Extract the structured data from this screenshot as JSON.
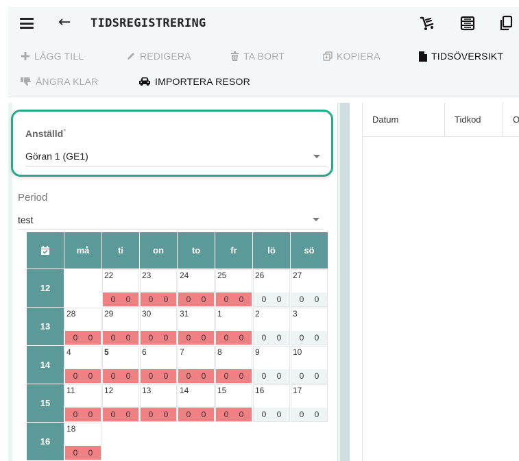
{
  "header": {
    "title": "TIDSREGISTRERING",
    "icons": [
      "cart-icon",
      "list-icon",
      "copy-icon"
    ]
  },
  "toolbar": {
    "add": "LÄGG TILL",
    "edit": "REDIGERA",
    "delete": "TA BORT",
    "copy": "KOPIERA",
    "overview": "TIDSÖVERSIKT",
    "undo_done": "ÅNGRA KLAR",
    "import_trips": "IMPORTERA RESOR"
  },
  "employee": {
    "label": "Anställd",
    "required_mark": "*",
    "value": "Göran 1 (GE1)"
  },
  "period": {
    "label": "Period",
    "value": "test"
  },
  "calendar": {
    "headers": [
      "må",
      "ti",
      "on",
      "to",
      "fr",
      "lö",
      "sö"
    ],
    "weeks": [
      {
        "week": "12",
        "days": [
          null,
          {
            "d": "22",
            "a": "0",
            "b": "0"
          },
          {
            "d": "23",
            "a": "0",
            "b": "0"
          },
          {
            "d": "24",
            "a": "0",
            "b": "0"
          },
          {
            "d": "25",
            "a": "0",
            "b": "0"
          },
          {
            "d": "26",
            "a": "0",
            "b": "0"
          },
          {
            "d": "27",
            "a": "0",
            "b": "0"
          }
        ]
      },
      {
        "week": "13",
        "days": [
          {
            "d": "28",
            "a": "0",
            "b": "0"
          },
          {
            "d": "29",
            "a": "0",
            "b": "0"
          },
          {
            "d": "30",
            "a": "0",
            "b": "0"
          },
          {
            "d": "31",
            "a": "0",
            "b": "0"
          },
          {
            "d": "1",
            "a": "0",
            "b": "0"
          },
          {
            "d": "2",
            "a": "0",
            "b": "0"
          },
          {
            "d": "3",
            "a": "0",
            "b": "0"
          }
        ]
      },
      {
        "week": "14",
        "days": [
          {
            "d": "4",
            "a": "0",
            "b": "0"
          },
          {
            "d": "5",
            "a": "0",
            "b": "0",
            "bold": true
          },
          {
            "d": "6",
            "a": "0",
            "b": "0"
          },
          {
            "d": "7",
            "a": "0",
            "b": "0"
          },
          {
            "d": "8",
            "a": "0",
            "b": "0"
          },
          {
            "d": "9",
            "a": "0",
            "b": "0"
          },
          {
            "d": "10",
            "a": "0",
            "b": "0"
          }
        ]
      },
      {
        "week": "15",
        "days": [
          {
            "d": "11",
            "a": "0",
            "b": "0"
          },
          {
            "d": "12",
            "a": "0",
            "b": "0"
          },
          {
            "d": "13",
            "a": "0",
            "b": "0"
          },
          {
            "d": "14",
            "a": "0",
            "b": "0"
          },
          {
            "d": "15",
            "a": "0",
            "b": "0"
          },
          {
            "d": "16",
            "a": "0",
            "b": "0"
          },
          {
            "d": "17",
            "a": "0",
            "b": "0"
          }
        ]
      },
      {
        "week": "16",
        "days": [
          {
            "d": "18",
            "a": "0",
            "b": "0"
          },
          null,
          null,
          null,
          null,
          null,
          null
        ]
      }
    ]
  },
  "table": {
    "columns": [
      "Datum",
      "Tidkod",
      "O"
    ]
  },
  "colors": {
    "accent": "#27a989",
    "calendar_header": "#5c9a9a",
    "workday_red": "#f08082",
    "weekend_gray": "#eef3f3"
  }
}
